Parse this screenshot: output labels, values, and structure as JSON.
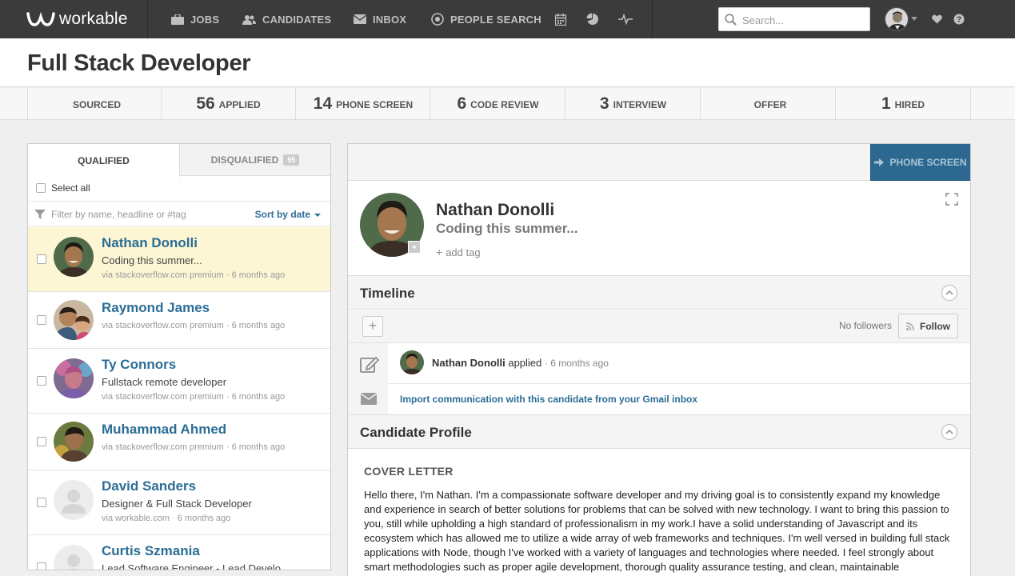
{
  "brand": {
    "name": "workable"
  },
  "nav": {
    "jobs": "JOBS",
    "candidates": "CANDIDATES",
    "inbox": "INBOX",
    "people_search": "PEOPLE SEARCH"
  },
  "search": {
    "placeholder": "Search..."
  },
  "page": {
    "title": "Full Stack Developer"
  },
  "stages": [
    {
      "count": "",
      "label": "SOURCED"
    },
    {
      "count": "56",
      "label": "APPLIED"
    },
    {
      "count": "14",
      "label": "PHONE SCREEN"
    },
    {
      "count": "6",
      "label": "CODE REVIEW"
    },
    {
      "count": "3",
      "label": "INTERVIEW"
    },
    {
      "count": "",
      "label": "OFFER"
    },
    {
      "count": "1",
      "label": "HIRED"
    }
  ],
  "list": {
    "tab_qualified": "QUALIFIED",
    "tab_disqualified": "DISQUALIFIED",
    "disqualified_count": "95",
    "select_all": "Select all",
    "filter_placeholder": "Filter by name, headline or #tag",
    "sort": "Sort by date",
    "candidates": [
      {
        "name": "Nathan Donolli",
        "headline": "Coding this summer...",
        "source": "via stackoverflow.com premium · 6 months ago"
      },
      {
        "name": "Raymond James",
        "headline": "",
        "source": "via stackoverflow.com premium · 6 months ago"
      },
      {
        "name": "Ty Connors",
        "headline": "Fullstack remote developer",
        "source": "via stackoverflow.com premium · 6 months ago"
      },
      {
        "name": "Muhammad Ahmed",
        "headline": "",
        "source": "via stackoverflow.com premium · 6 months ago"
      },
      {
        "name": "David Sanders",
        "headline": "Designer & Full Stack Developer",
        "source": "via workable.com · 6 months ago"
      },
      {
        "name": "Curtis Szmania",
        "headline": "Lead Software Engineer - Lead Develo",
        "source": ""
      }
    ]
  },
  "detail": {
    "move_button": "PHONE SCREEN",
    "name": "Nathan Donolli",
    "headline": "Coding this summer...",
    "add_tag": "add tag",
    "timeline": {
      "title": "Timeline",
      "no_followers": "No followers",
      "follow": "Follow",
      "event_name": "Nathan Donolli",
      "event_action": "applied",
      "event_ago": "· 6 months ago",
      "import_link": "Import communication with this candidate from your Gmail inbox"
    },
    "profile": {
      "title": "Candidate Profile",
      "cover_title": "COVER LETTER",
      "cover_text": "Hello there, I'm Nathan.  I'm a compassionate software developer and my driving goal is to consistently expand my knowledge and experience in search of better solutions for problems that can be solved with new technology.  I want to bring this passion to you, still while upholding a high standard of professionalism in my work.I have a solid understanding of Javascript and its ecosystem which has allowed me to utilize a wide array of web frameworks and techniques.  I'm well versed in building full stack applications with Node, though I've worked with a variety of languages and technologies where needed.  I feel strongly about smart methodologies such as proper agile development, thorough quality assurance testing, and clean, maintainable"
    }
  },
  "colors": {
    "nav_bg": "#3b3b3b",
    "link": "#2b6d95",
    "selected_row": "#fdf6d4",
    "primary_button": "#2c6890"
  }
}
